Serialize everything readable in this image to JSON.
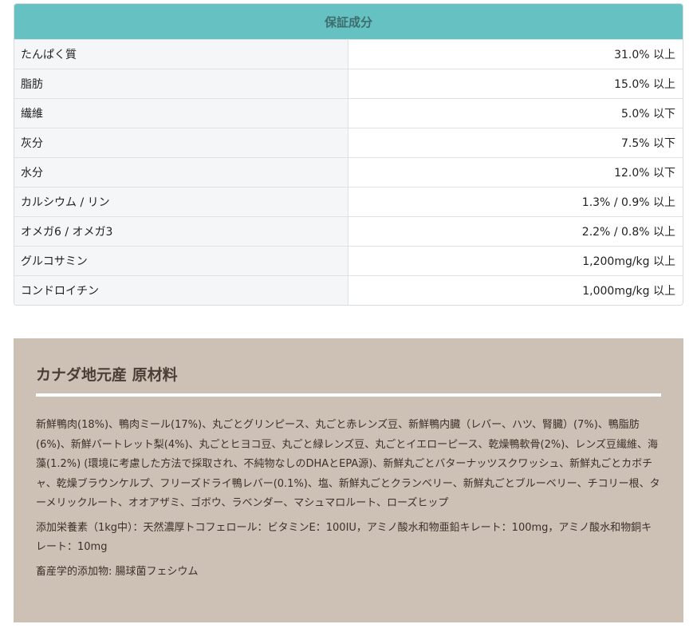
{
  "nutrition": {
    "header": "保証成分",
    "rows": [
      {
        "label": "たんぱく質",
        "value": "31.0% 以上"
      },
      {
        "label": "脂肪",
        "value": "15.0% 以上"
      },
      {
        "label": "繊維",
        "value": "5.0% 以下"
      },
      {
        "label": "灰分",
        "value": "7.5% 以下"
      },
      {
        "label": "水分",
        "value": "12.0% 以下"
      },
      {
        "label": "カルシウム / リン",
        "value": "1.3% / 0.9% 以上"
      },
      {
        "label": "オメガ6 / オメガ3",
        "value": "2.2% / 0.8% 以上"
      },
      {
        "label": "グルコサミン",
        "value": "1,200mg/kg 以上"
      },
      {
        "label": "コンドロイチン",
        "value": "1,000mg/kg 以上"
      }
    ]
  },
  "ingredients": {
    "title": "カナダ地元産 原材料",
    "main": "新鮮鴨肉(18%)、鴨肉ミール(17%)、丸ごとグリンピース、丸ごと赤レンズ豆、新鮮鴨内臓（レバー、ハツ、腎臓）(7%)、鴨脂肪(6%)、新鮮バートレット梨(4%)、丸ごとヒヨコ豆、丸ごと緑レンズ豆、丸ごとイエローピース、乾燥鴨軟骨(2%)、レンズ豆繊維、海藻(1.2%) (環境に考慮した方法で採取され、不純物なしのDHAとEPA源)、新鮮丸ごとバターナッツスクワッシュ、新鮮丸ごとカボチャ、乾燥ブラウンケルプ、フリーズドライ鴨レバー(0.1%)、塩、新鮮丸ごとクランベリー、新鮮丸ごとブルーベリー、チコリー根、ターメリックルート、オオアザミ、ゴボウ、ラベンダー、マシュマロルート、ローズヒップ",
    "additives": "添加栄養素（1kg中）：天然濃厚トコフェロール：ビタミンE：100IU，アミノ酸水和物亜鉛キレート：100mg，アミノ酸水和物銅キレート：10mg",
    "zootechnical": "畜産学的添加物: 腸球菌フェシウム"
  }
}
